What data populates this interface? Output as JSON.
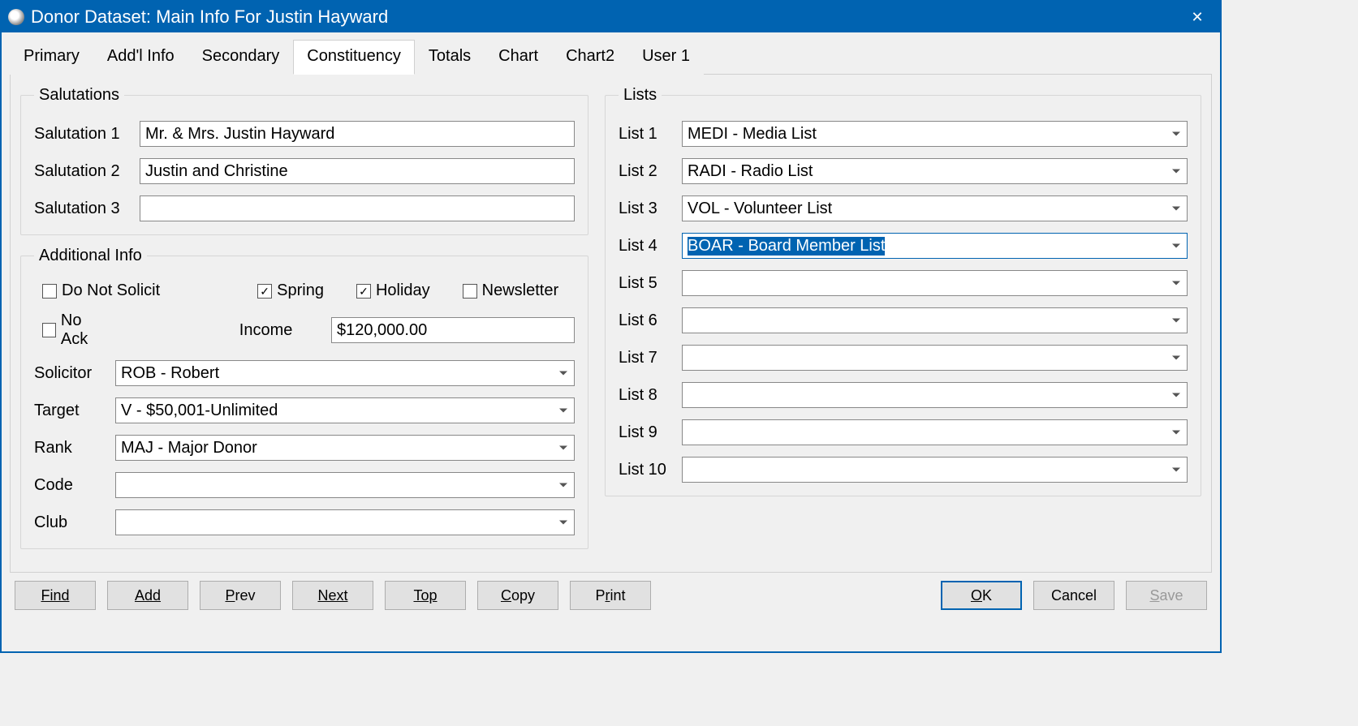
{
  "title": "Donor Dataset: Main Info For Justin Hayward",
  "tabs": [
    "Primary",
    "Add'l Info",
    "Secondary",
    "Constituency",
    "Totals",
    "Chart",
    "Chart2",
    "User 1"
  ],
  "activeTab": "Constituency",
  "salutations": {
    "legend": "Salutations",
    "rows": [
      {
        "label": "Salutation 1",
        "value": "Mr. & Mrs. Justin Hayward"
      },
      {
        "label": "Salutation 2",
        "value": "Justin and Christine"
      },
      {
        "label": "Salutation 3",
        "value": ""
      }
    ]
  },
  "additional": {
    "legend": "Additional Info",
    "doNotSolicit": {
      "label": "Do Not Solicit",
      "checked": false
    },
    "spring": {
      "label": "Spring",
      "checked": true
    },
    "holiday": {
      "label": "Holiday",
      "checked": true
    },
    "newsletter": {
      "label": "Newsletter",
      "checked": false
    },
    "noAck": {
      "label": "No Ack",
      "checked": false
    },
    "incomeLabel": "Income",
    "incomeValue": "$120,000.00",
    "solicitor": {
      "label": "Solicitor",
      "value": "ROB - Robert"
    },
    "target": {
      "label": "Target",
      "value": "V - $50,001-Unlimited"
    },
    "rank": {
      "label": "Rank",
      "value": "MAJ - Major Donor"
    },
    "code": {
      "label": "Code",
      "value": ""
    },
    "club": {
      "label": "Club",
      "value": ""
    }
  },
  "lists": {
    "legend": "Lists",
    "items": [
      {
        "label": "List 1",
        "value": "MEDI - Media List"
      },
      {
        "label": "List 2",
        "value": "RADI - Radio List"
      },
      {
        "label": "List 3",
        "value": "VOL - Volunteer List"
      },
      {
        "label": "List 4",
        "value": "BOAR - Board Member List",
        "selected": true
      },
      {
        "label": "List 5",
        "value": ""
      },
      {
        "label": "List 6",
        "value": ""
      },
      {
        "label": "List 7",
        "value": ""
      },
      {
        "label": "List 8",
        "value": ""
      },
      {
        "label": "List 9",
        "value": ""
      },
      {
        "label": "List 10",
        "value": ""
      }
    ]
  },
  "buttons": {
    "find": "Find",
    "add": "Add",
    "prev": "Prev",
    "next": "Next",
    "top": "Top",
    "copy": "Copy",
    "print": "Print",
    "ok": "OK",
    "cancel": "Cancel",
    "save": "Save"
  }
}
